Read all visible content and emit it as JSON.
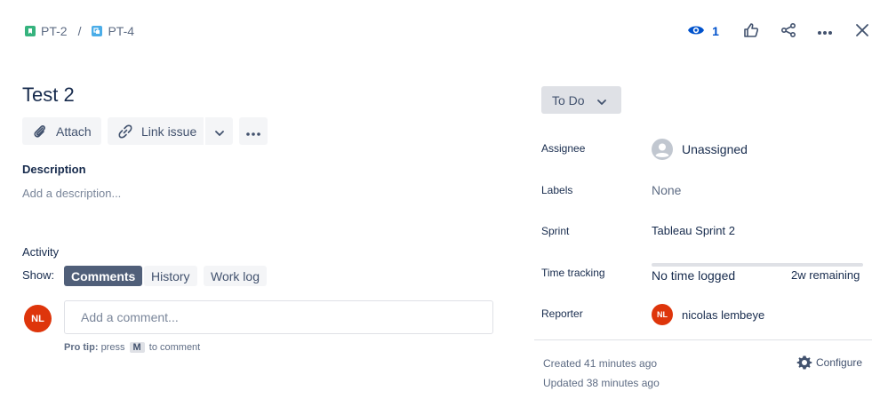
{
  "breadcrumb": {
    "parent": "PT-2",
    "separator": "/",
    "current": "PT-4",
    "parent_color": "#36b37e",
    "current_color": "#4bade8"
  },
  "toolbar": {
    "watch_count": "1",
    "watch_icon": "eye-icon",
    "like_icon": "thumbs-up-icon",
    "share_icon": "share-icon",
    "more_icon": "more-icon",
    "close_icon": "close-icon"
  },
  "issue": {
    "title": "Test 2"
  },
  "actions": {
    "attach": "Attach",
    "link_issue": "Link issue"
  },
  "description": {
    "heading": "Description",
    "placeholder": "Add a description..."
  },
  "activity": {
    "heading": "Activity",
    "show_label": "Show:",
    "tabs": [
      "Comments",
      "History",
      "Work log"
    ],
    "active_tab": "Comments"
  },
  "comment": {
    "user_initials": "NL",
    "avatar_color": "#de350b",
    "placeholder": "Add a comment...",
    "tip_bold": "Pro tip:",
    "tip_pre": "press",
    "tip_key": "M",
    "tip_post": "to comment"
  },
  "status": {
    "label": "To Do"
  },
  "fields": {
    "assignee_label": "Assignee",
    "assignee_value": "Unassigned",
    "labels_label": "Labels",
    "labels_value": "None",
    "sprint_label": "Sprint",
    "sprint_value": "Tableau Sprint 2",
    "time_label": "Time tracking",
    "time_logged": "No time logged",
    "time_remaining": "2w remaining",
    "time_progress": 0,
    "reporter_label": "Reporter",
    "reporter_initials": "NL",
    "reporter_name": "nicolas lembeye"
  },
  "meta": {
    "created": "Created 41 minutes ago",
    "updated": "Updated 38 minutes ago",
    "configure": "Configure"
  },
  "colors": {
    "accent": "#0052cc",
    "text": "#172b4d",
    "muted": "#7a869a",
    "active_tab_bg": "#505f79"
  }
}
